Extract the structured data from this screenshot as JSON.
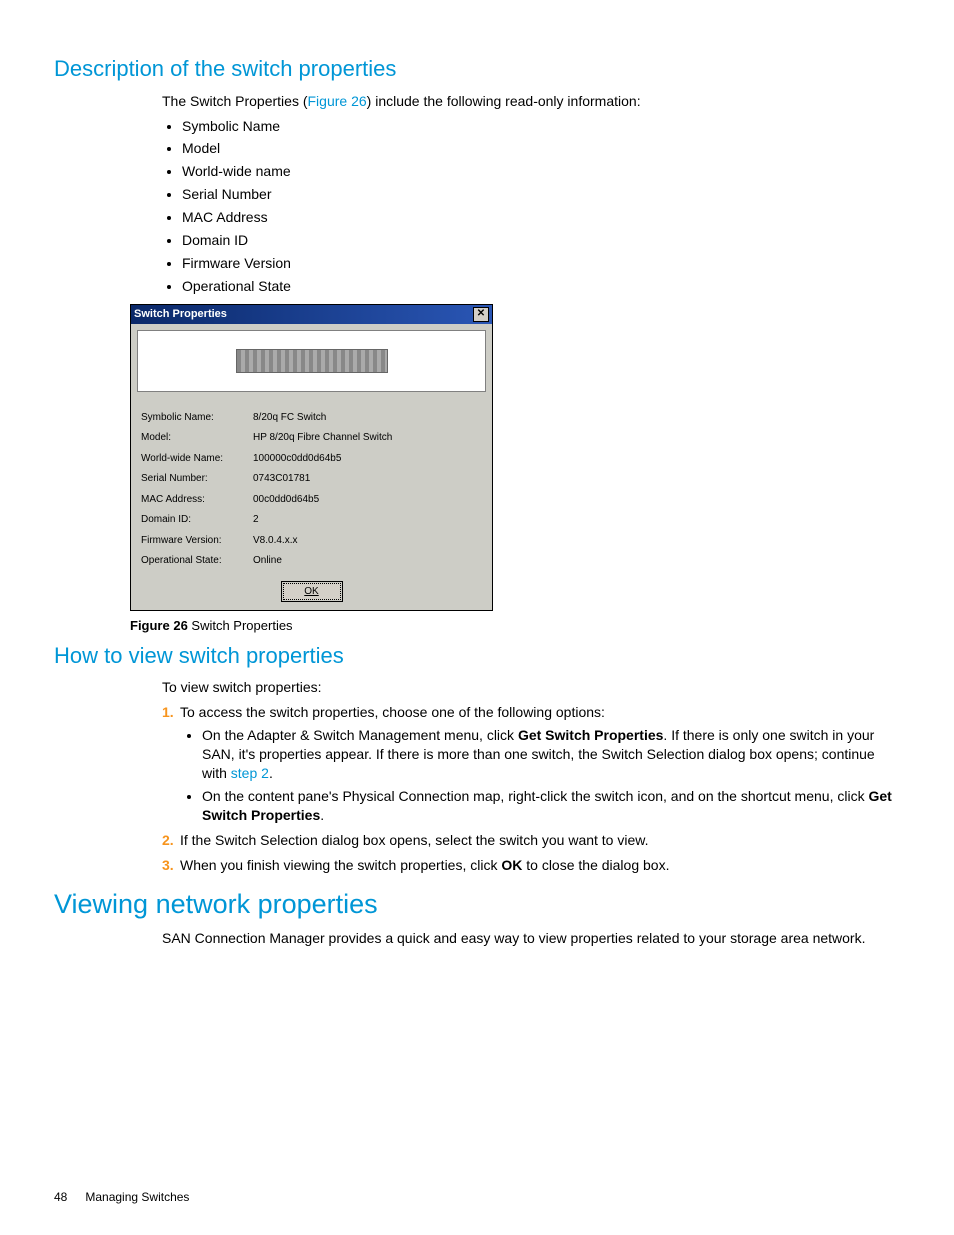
{
  "sec1": {
    "heading": "Description of the switch properties",
    "intro_pre": "The Switch Properties (",
    "intro_link": "Figure 26",
    "intro_post": ") include the following read-only information:",
    "bullets": [
      "Symbolic Name",
      "Model",
      "World-wide name",
      "Serial Number",
      "MAC Address",
      "Domain ID",
      "Firmware Version",
      "Operational State"
    ]
  },
  "dialog": {
    "title": "Switch Properties",
    "rows": [
      {
        "label": "Symbolic Name:",
        "value": "8/20q FC Switch"
      },
      {
        "label": "Model:",
        "value": "HP 8/20q Fibre Channel Switch"
      },
      {
        "label": "World-wide Name:",
        "value": "100000c0dd0d64b5"
      },
      {
        "label": "Serial Number:",
        "value": "0743C01781"
      },
      {
        "label": "MAC Address:",
        "value": "00c0dd0d64b5"
      },
      {
        "label": "Domain ID:",
        "value": "2"
      },
      {
        "label": "Firmware Version:",
        "value": "V8.0.4.x.x"
      },
      {
        "label": "Operational State:",
        "value": "Online"
      }
    ],
    "ok": "OK"
  },
  "caption": {
    "fig": "Figure 26",
    "text": " Switch Properties"
  },
  "sec2": {
    "heading": "How to view switch properties",
    "intro": "To view switch properties:",
    "step1": "To access the switch properties, choose one of the following options:",
    "sub1a_pre": "On the Adapter & Switch Management menu, click ",
    "sub1a_bold": "Get Switch Properties",
    "sub1a_mid": ". If there is only one switch in your SAN, it's properties appear. If there is more than one switch, the Switch Selection dialog box opens; continue with ",
    "sub1a_link": "step 2",
    "sub1a_post": ".",
    "sub1b_pre": "On the content pane's Physical Connection map, right-click the switch icon, and on the shortcut menu, click ",
    "sub1b_bold": "Get Switch Properties",
    "sub1b_post": ".",
    "step2": "If the Switch Selection dialog box opens, select the switch you want to view.",
    "step3_pre": "When you finish viewing the switch properties, click ",
    "step3_bold": "OK",
    "step3_post": " to close the dialog box."
  },
  "sec3": {
    "heading": "Viewing network properties",
    "body": "SAN Connection Manager provides a quick and easy way to view properties related to your storage area network."
  },
  "footer": {
    "page": "48",
    "section": "Managing Switches"
  }
}
